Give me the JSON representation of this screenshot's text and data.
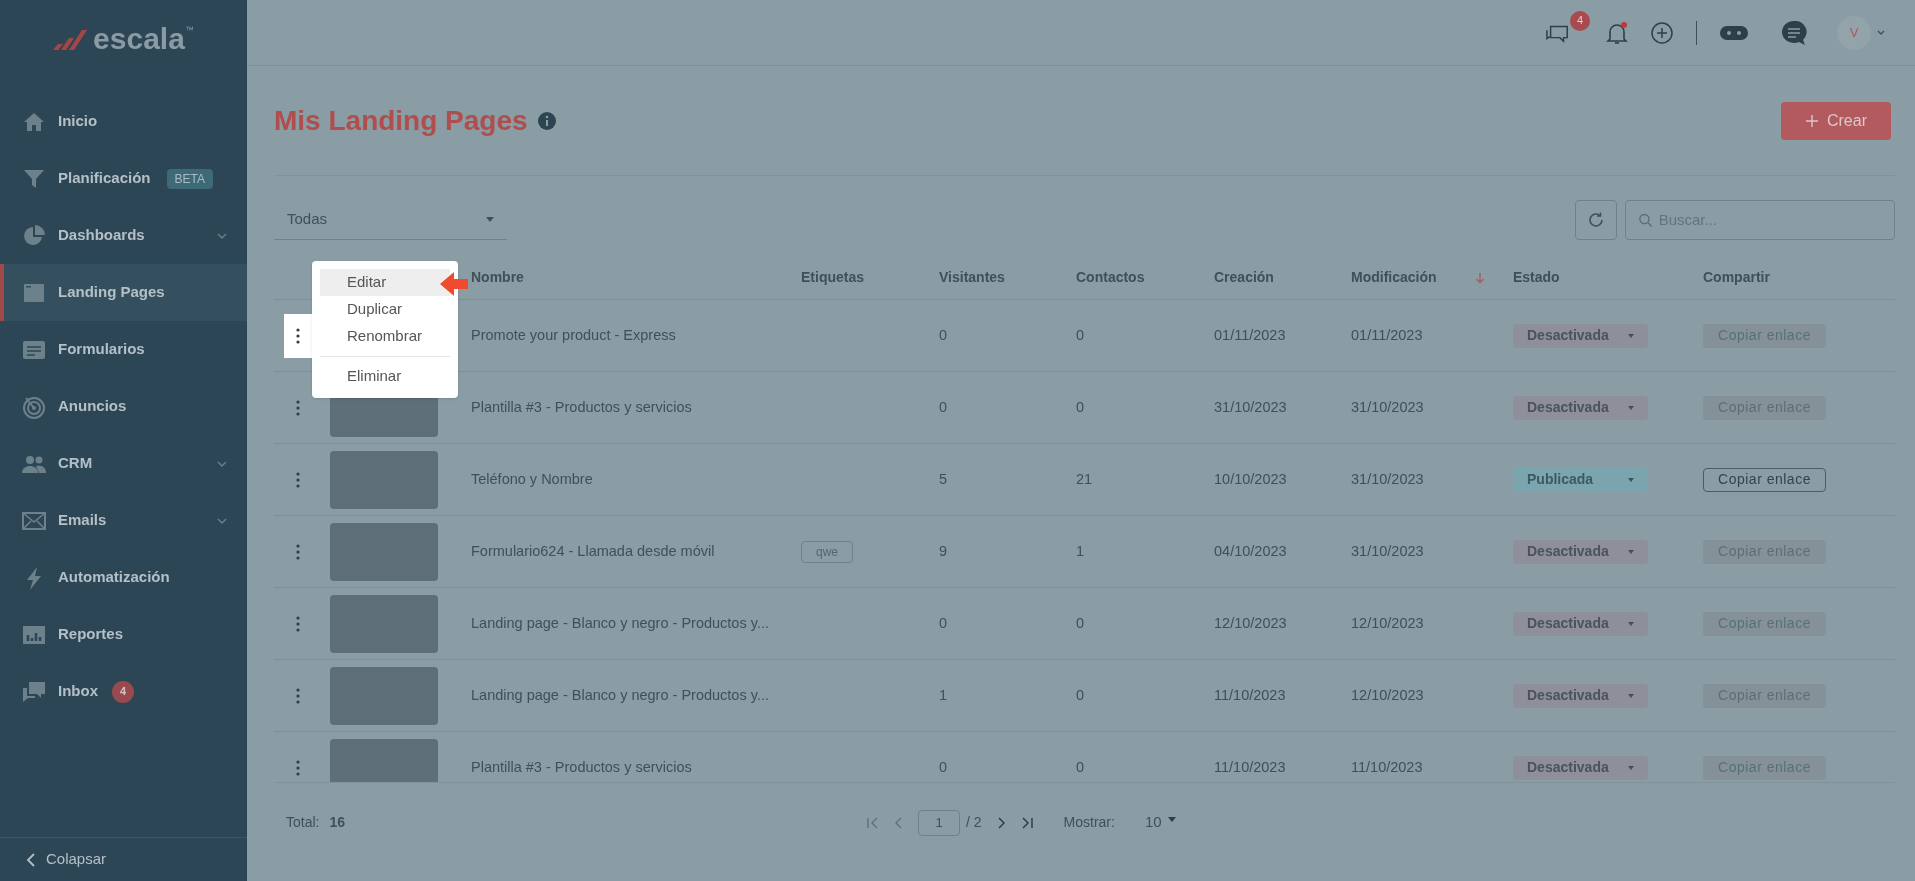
{
  "logo": {
    "text": "escala",
    "trademark": "™"
  },
  "sidebar": {
    "items": [
      {
        "label": "Inicio",
        "selected": false,
        "expandable": false
      },
      {
        "label": "Planificación",
        "selected": false,
        "expandable": false,
        "badge": {
          "text": "BETA",
          "kind": "tag"
        }
      },
      {
        "label": "Dashboards",
        "selected": false,
        "expandable": true
      },
      {
        "label": "Landing Pages",
        "selected": true,
        "expandable": false
      },
      {
        "label": "Formularios",
        "selected": false,
        "expandable": false
      },
      {
        "label": "Anuncios",
        "selected": false,
        "expandable": false
      },
      {
        "label": "CRM",
        "selected": false,
        "expandable": true
      },
      {
        "label": "Emails",
        "selected": false,
        "expandable": true
      },
      {
        "label": "Automatización",
        "selected": false,
        "expandable": false
      },
      {
        "label": "Reportes",
        "selected": false,
        "expandable": false
      },
      {
        "label": "Inbox",
        "selected": false,
        "expandable": false,
        "badge": {
          "text": "4",
          "kind": "count"
        }
      }
    ],
    "collapse": "Colapsar"
  },
  "topbar": {
    "messages_badge": "4",
    "notification_unread": true,
    "avatar": "V"
  },
  "page": {
    "title": "Mis Landing Pages",
    "create_button": "Crear",
    "filter": "Todas",
    "search": {
      "placeholder": "Buscar..."
    }
  },
  "table": {
    "columns": [
      {
        "label": "Nombre",
        "sorted": false
      },
      {
        "label": "Etiquetas",
        "sorted": false
      },
      {
        "label": "Visitantes",
        "sorted": false
      },
      {
        "label": "Contactos",
        "sorted": false
      },
      {
        "label": "Creación",
        "sorted": false
      },
      {
        "label": "Modificación",
        "sorted": true
      },
      {
        "label": "Estado",
        "sorted": false
      },
      {
        "label": "Compartir",
        "sorted": false
      }
    ],
    "rows": [
      {
        "menu_open": true,
        "name": "Promote your product - Express",
        "tags": [],
        "visitors": "0",
        "contacts": "0",
        "created": "01/11/2023",
        "modified": "01/11/2023",
        "status": {
          "label": "Desactivada",
          "kind": "inactive"
        },
        "share": {
          "label": "Copiar enlace",
          "enabled": false
        }
      },
      {
        "menu_open": false,
        "name": "Plantilla #3 - Productos y servicios",
        "tags": [],
        "visitors": "0",
        "contacts": "0",
        "created": "31/10/2023",
        "modified": "31/10/2023",
        "status": {
          "label": "Desactivada",
          "kind": "inactive"
        },
        "share": {
          "label": "Copiar enlace",
          "enabled": false
        }
      },
      {
        "menu_open": false,
        "name": "Teléfono y Nombre",
        "tags": [],
        "visitors": "5",
        "contacts": "21",
        "created": "10/10/2023",
        "modified": "31/10/2023",
        "status": {
          "label": "Publicada",
          "kind": "published"
        },
        "share": {
          "label": "Copiar enlace",
          "enabled": true
        }
      },
      {
        "menu_open": false,
        "name": "Formulario624 - Llamada desde móvil",
        "tags": [
          "qwe"
        ],
        "visitors": "9",
        "contacts": "1",
        "created": "04/10/2023",
        "modified": "31/10/2023",
        "status": {
          "label": "Desactivada",
          "kind": "inactive"
        },
        "share": {
          "label": "Copiar enlace",
          "enabled": false
        }
      },
      {
        "menu_open": false,
        "name": "Landing page - Blanco y negro - Productos y...",
        "tags": [],
        "visitors": "0",
        "contacts": "0",
        "created": "12/10/2023",
        "modified": "12/10/2023",
        "status": {
          "label": "Desactivada",
          "kind": "inactive"
        },
        "share": {
          "label": "Copiar enlace",
          "enabled": false
        }
      },
      {
        "menu_open": false,
        "name": "Landing page - Blanco y negro - Productos y...",
        "tags": [],
        "visitors": "1",
        "contacts": "0",
        "created": "11/10/2023",
        "modified": "12/10/2023",
        "status": {
          "label": "Desactivada",
          "kind": "inactive"
        },
        "share": {
          "label": "Copiar enlace",
          "enabled": false
        }
      },
      {
        "menu_open": false,
        "name": "Plantilla #3 - Productos y servicios",
        "tags": [],
        "visitors": "0",
        "contacts": "0",
        "created": "11/10/2023",
        "modified": "11/10/2023",
        "status": {
          "label": "Desactivada",
          "kind": "inactive"
        },
        "share": {
          "label": "Copiar enlace",
          "enabled": false
        }
      }
    ]
  },
  "context_menu": {
    "groups": [
      [
        {
          "label": "Editar",
          "selected": true
        },
        {
          "label": "Duplicar",
          "selected": false
        },
        {
          "label": "Renombrar",
          "selected": false
        }
      ],
      [
        {
          "label": "Eliminar",
          "selected": false
        }
      ]
    ]
  },
  "footer": {
    "total_label": "Total:",
    "total": "16",
    "page": "1",
    "pages": "/ 2",
    "show_label": "Mostrar:",
    "page_size": "10"
  }
}
